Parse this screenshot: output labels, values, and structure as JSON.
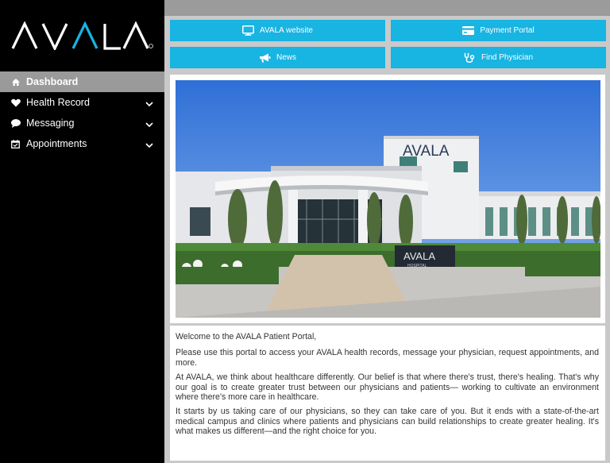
{
  "brand": {
    "logo_text": "AVALA"
  },
  "sidebar": {
    "items": [
      {
        "label": "Dashboard",
        "icon": "home-icon",
        "active": true
      },
      {
        "label": "Health Record",
        "icon": "heart-icon"
      },
      {
        "label": "Messaging",
        "icon": "chat-bubble-icon"
      },
      {
        "label": "Appointments",
        "icon": "calendar-check-icon"
      }
    ]
  },
  "quick_links": [
    {
      "label": "AVALA website",
      "icon": "monitor-icon"
    },
    {
      "label": "Payment Portal",
      "icon": "credit-card-icon"
    },
    {
      "label": "News",
      "icon": "megaphone-icon"
    },
    {
      "label": "Find Physician",
      "icon": "stethoscope-icon"
    }
  ],
  "photo": {
    "building_sign": "AVALA",
    "ground_sign": "AVALA",
    "ground_sign_sub": "HOSPITAL"
  },
  "welcome": {
    "greeting": "Welcome to the AVALA Patient Portal,",
    "p1": "Please use this portal to access your AVALA health records, message your physician, request appointments, and more.",
    "p2": "At AVALA, we think about healthcare differently. Our belief is that where there's trust, there's healing. That's why our goal is to create greater trust between our physicians and patients— working to cultivate an environment where there's more care in healthcare.",
    "p3": "It starts by us taking care of our physicians, so they can take care of you. But it ends with a state-of-the-art medical campus and clinics where patients and physicians can build relationships to create greater healing. It's what makes us different—and the right choice for you."
  },
  "colors": {
    "accent": "#18b4e2",
    "sidebar_bg": "#000000",
    "active_item_bg": "#9a9a9a"
  }
}
